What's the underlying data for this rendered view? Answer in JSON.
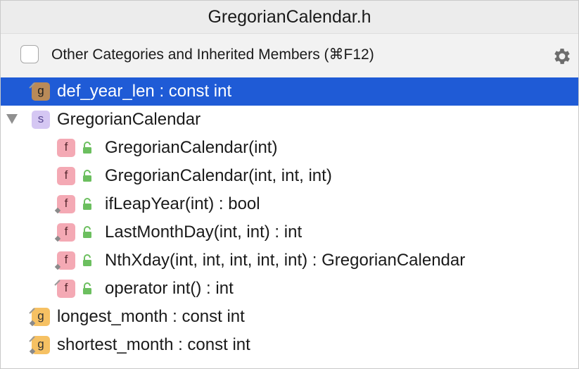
{
  "window": {
    "title": "GregorianCalendar.h"
  },
  "filter": {
    "checkbox_label": "Other Categories and Inherited Members (⌘F12)",
    "checked": false,
    "settings_icon": "gear-icon"
  },
  "tree": {
    "rows": [
      {
        "label": "def_year_len : const int",
        "kind": "g",
        "selected": true
      },
      {
        "label": "GregorianCalendar",
        "kind": "s",
        "expanded": true
      },
      {
        "label": "GregorianCalendar(int)",
        "kind": "f",
        "access": "public"
      },
      {
        "label": "GregorianCalendar(int, int, int)",
        "kind": "f",
        "access": "public"
      },
      {
        "label": "ifLeapYear(int) : bool",
        "kind": "f",
        "access": "public",
        "virtual": true
      },
      {
        "label": "LastMonthDay(int, int) : int",
        "kind": "f",
        "access": "public",
        "virtual": true
      },
      {
        "label": "NthXday(int, int, int, int, int) : GregorianCalendar",
        "kind": "f",
        "access": "public",
        "virtual": true
      },
      {
        "label": "operator int() : int",
        "kind": "f",
        "access": "public",
        "virtual": true
      },
      {
        "label": "longest_month : const int",
        "kind": "g"
      },
      {
        "label": "shortest_month : const int",
        "kind": "g"
      }
    ],
    "badge_letters": {
      "g": "g",
      "s": "s",
      "f": "f"
    }
  },
  "colors": {
    "selection": "#1f5bd6",
    "global_badge": "#f6c163",
    "struct_badge": "#d5c7f3",
    "function_badge": "#f4a9b4",
    "lock": "#6cbf5f"
  }
}
